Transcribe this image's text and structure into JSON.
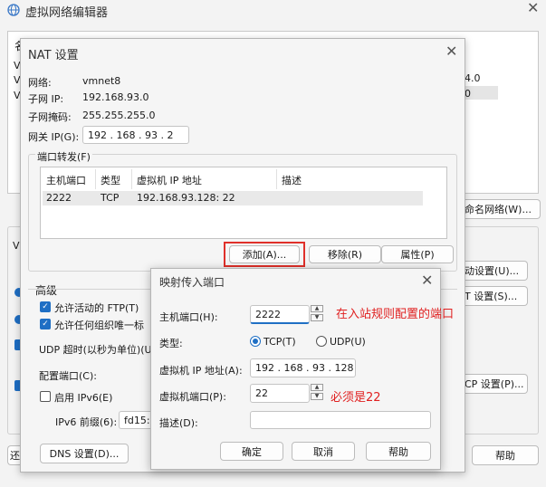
{
  "main_window": {
    "title": "虚拟网络编辑器",
    "table_col_fragment": "名",
    "row_fragments": [
      "V",
      "V",
      "V"
    ],
    "right_fragments": [
      "4.0",
      "0"
    ],
    "rename_button": "命名网络(W)...",
    "dhcp_fragment": "动设置(U)...",
    "nat_settings_fragment": "T 设置(S)...",
    "dhcp_settings_fragment": "CP 设置(P)...",
    "help_button": "帮助",
    "left_fragment_1": "V",
    "bottom_left_fragment": "还",
    "bottom_n_fragment": "N"
  },
  "nat_dialog": {
    "title": "NAT 设置",
    "network_label": "网络:",
    "network_value": "vmnet8",
    "subnet_ip_label": "子网 IP:",
    "subnet_ip_value": "192.168.93.0",
    "subnet_mask_label": "子网掩码:",
    "subnet_mask_value": "255.255.255.0",
    "gateway_label": "网关 IP(G):",
    "gateway_value": "192 . 168 . 93  .  2",
    "port_forward_label": "端口转发(F)",
    "columns": [
      "主机端口",
      "类型",
      "虚拟机 IP 地址",
      "描述"
    ],
    "rows": [
      {
        "host_port": "2222",
        "type": "TCP",
        "vm_ip": "192.168.93.128: 22",
        "desc": ""
      }
    ],
    "add_button": "添加(A)...",
    "remove_button": "移除(R)",
    "properties_button": "属性(P)",
    "advanced_label": "高级",
    "allow_ftp": "允许活动的 FTP(T)",
    "allow_any_org": "允许任何组织唯一标",
    "udp_timeout": "UDP 超时(以秒为单位)(U",
    "config_port": "配置端口(C):",
    "enable_ipv6": "启用 IPv6(E)",
    "ipv6_prefix_label": "IPv6 前缀(6):",
    "ipv6_prefix_value": "fd15:4",
    "dns_button": "DNS 设置(D)..."
  },
  "map_dialog": {
    "title": "映射传入端口",
    "host_port_label": "主机端口(H):",
    "host_port_value": "2222",
    "host_port_note": "在入站规则配置的端口",
    "type_label": "类型:",
    "type_tcp": "TCP(T)",
    "type_udp": "UDP(U)",
    "vm_ip_label": "虚拟机 IP 地址(A):",
    "vm_ip_value": "192 . 168 . 93  . 128",
    "vm_port_label": "虚拟机端口(P):",
    "vm_port_value": "22",
    "vm_port_note": "必须是22",
    "desc_label": "描述(D):",
    "desc_value": "",
    "ok_button": "确定",
    "cancel_button": "取消",
    "help_button": "帮助"
  },
  "colors": {
    "accent": "#1f6fc4",
    "annotation_red": "#e02020",
    "highlight_box": "#e0302a"
  }
}
